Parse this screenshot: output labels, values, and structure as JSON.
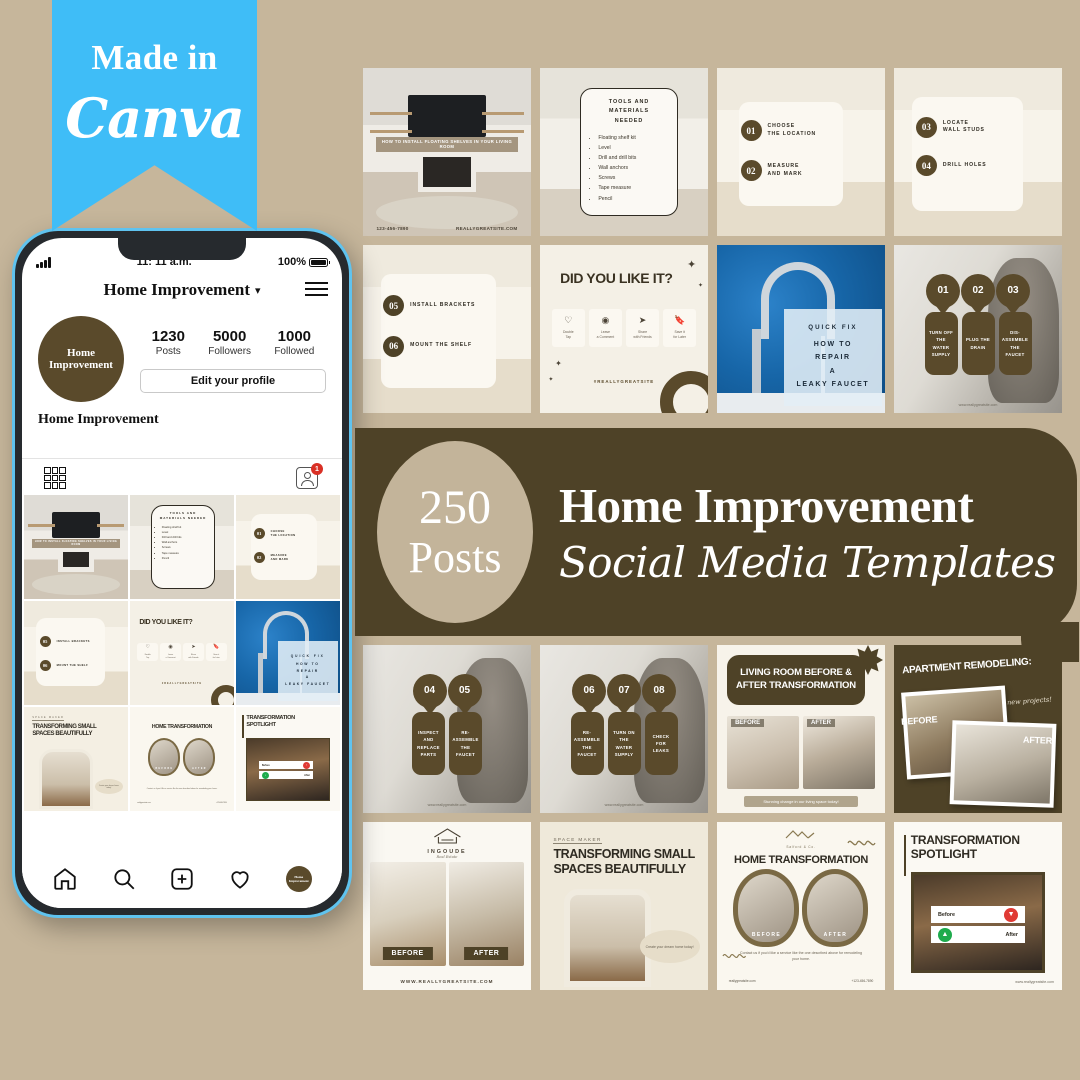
{
  "theme": {
    "background": "#c6b69b",
    "brown": "#4e4227",
    "brown_light": "#5a4a2b",
    "cream": "#f4efe3",
    "canva_blue": "#3fbdf7",
    "accent_tan": "#c3b49a"
  },
  "ribbon": {
    "line1": "Made in",
    "line2": "Canva"
  },
  "phone": {
    "status": {
      "time": "11: 11 a.m.",
      "battery": "100%"
    },
    "header": {
      "title": "Home Improvement",
      "chevron": "chevron-down-icon",
      "menu": "hamburger-icon"
    },
    "profile": {
      "avatar_label": "Home Improvement",
      "bio_name": "Home Improvement",
      "edit_button": "Edit your profile",
      "stats": [
        {
          "value": "1230",
          "label": "Posts"
        },
        {
          "value": "5000",
          "label": "Followers"
        },
        {
          "value": "1000",
          "label": "Followed"
        }
      ]
    },
    "tabs": {
      "grid": "grid-icon",
      "tagged": "tagged-icon",
      "tagged_badge": "1"
    },
    "bottom_nav": [
      "home-icon",
      "search-icon",
      "add-post-icon",
      "heart-icon",
      "profile-avatar-icon"
    ]
  },
  "banner": {
    "count": "250",
    "count_label": "Posts",
    "title": "Home Improvement",
    "subtitle": "Social Media Templates"
  },
  "top_cards": [
    {
      "id": "floating-shelves-cover",
      "strip": "HOW TO INSTALL FLOATING SHELVES IN YOUR LIVING ROOM",
      "phone": "123-456-7890",
      "site": "REALLYGREATSITE.COM"
    },
    {
      "id": "tools-and-materials",
      "title_line1": "TOOLS AND MATERIALS",
      "title_line2": "NEEDED",
      "items": [
        "Floating shelf kit",
        "Level",
        "Drill and drill bits",
        "Wall anchors",
        "Screws",
        "Tape measure",
        "Pencil"
      ]
    },
    {
      "id": "steps-01-02",
      "steps": [
        {
          "num": "01",
          "text": "CHOOSE\nTHE LOCATION"
        },
        {
          "num": "02",
          "text": "MEASURE\nAND MARK"
        }
      ]
    },
    {
      "id": "steps-03-04",
      "steps": [
        {
          "num": "03",
          "text": "LOCATE\nWALL STUDS"
        },
        {
          "num": "04",
          "text": "DRILL HOLES"
        }
      ]
    },
    {
      "id": "steps-05-06",
      "steps": [
        {
          "num": "05",
          "text": "INSTALL BRACKETS"
        },
        {
          "num": "06",
          "text": "MOUNT THE SHELF"
        }
      ]
    },
    {
      "id": "did-you-like-it",
      "title": "DID YOU LIKE IT?",
      "actions": [
        {
          "icon": "heart-icon",
          "label": "Double\nTap"
        },
        {
          "icon": "comment-icon",
          "label": "Leave\na Comment"
        },
        {
          "icon": "share-icon",
          "label": "Share\nwith Friends"
        },
        {
          "icon": "bookmark-icon",
          "label": "Save it\nfor Later"
        }
      ],
      "hashtag": "#REALLYGREATSITE"
    },
    {
      "id": "leaky-faucet-cover",
      "kicker": "QUICK FIX",
      "headline": "HOW TO\nREPAIR\nA\nLEAKY FAUCET"
    },
    {
      "id": "faucet-steps-01-03",
      "tags": [
        "01",
        "02",
        "03"
      ],
      "pills": [
        "TURN OFF\nTHE\nWATER\nSUPPLY",
        "PLUG THE\nDRAIN",
        "DIS-\nASSEMBLE\nTHE\nFAUCET"
      ],
      "site": "www.reallygreatsite.com"
    }
  ],
  "bottom_cards": [
    {
      "id": "faucet-steps-04-05",
      "tags": [
        "04",
        "05"
      ],
      "pills": [
        "INSPECT\nAND\nREPLACE\nPARTS",
        "RE-\nASSEMBLE\nTHE\nFAUCET"
      ],
      "site": "www.reallygreatsite.com"
    },
    {
      "id": "faucet-steps-06-08",
      "tags": [
        "06",
        "07",
        "08"
      ],
      "pills": [
        "RE-\nASSEMBLE\nTHE\nFAUCET",
        "TURN ON\nTHE WATER\nSUPPLY",
        "CHECK FOR\nLEAKS"
      ],
      "site": "www.reallygreatsite.com"
    },
    {
      "id": "living-room-before-after",
      "title": "LIVING ROOM BEFORE &\nAFTER TRANSFORMATION",
      "before_label": "BEFORE",
      "after_label": "AFTER",
      "caption": "Stunning change in our living space today!"
    },
    {
      "id": "apartment-remodeling",
      "title": "APARTMENT REMODELING:",
      "subtitle": "new projects!",
      "before_label": "BEFORE",
      "after_label": "AFTER"
    },
    {
      "id": "ingoude-before-after",
      "logo_name": "INGOUDE",
      "logo_sub": "Real Estate",
      "before_label": "BEFORE",
      "after_label": "AFTER",
      "website": "WWW.REALLYGREATSITE.COM"
    },
    {
      "id": "transforming-small-spaces",
      "kicker": "SPACE MAKER",
      "title": "TRANSFORMING SMALL\nSPACES BEAUTIFULLY",
      "note": "Create your dream home today!"
    },
    {
      "id": "home-transformation",
      "logo": "Salford & Co.",
      "title": "HOME TRANSFORMATION",
      "before_label": "BEFORE",
      "after_label": "AFTER",
      "body": "Contact us if you'd like a service like the one described above for remodeling your home.",
      "contact_label": "More Information",
      "contact_email": "reallygreatsite.com",
      "phone_label": "Contact us",
      "phone": "+123-456-7890"
    },
    {
      "id": "transformation-spotlight",
      "title": "TRANSFORMATION\nSPOTLIGHT",
      "before_label": "Before",
      "after_label": "After",
      "website": "www.reallygreatsite.com"
    }
  ],
  "phone_grid": [
    {
      "id": "floating-shelves-cover"
    },
    {
      "id": "tools-and-materials",
      "title": "TOOLS AND MATERIALS NEEDED"
    },
    {
      "id": "steps-01-02",
      "steps": [
        "01 CHOOSE THE LOCATION",
        "02 MEASURE AND MARK"
      ]
    },
    {
      "id": "steps-05-06",
      "steps": [
        "05 INSTALL BRACKETS",
        "06 MOUNT THE SHELF"
      ]
    },
    {
      "id": "did-you-like-it",
      "title": "DID YOU LIKE IT?"
    },
    {
      "id": "leaky-faucet-cover",
      "kicker": "QUICK FIX",
      "headline": "HOW TO REPAIR A LEAKY FAUCET"
    },
    {
      "id": "transforming-small-spaces",
      "title": "TRANSFORMING SMALL SPACES BEAUTIFULLY"
    },
    {
      "id": "home-transformation",
      "title": "HOME TRANSFORMATION"
    },
    {
      "id": "transformation-spotlight",
      "title": "TRANSFORMATION SPOTLIGHT"
    }
  ]
}
